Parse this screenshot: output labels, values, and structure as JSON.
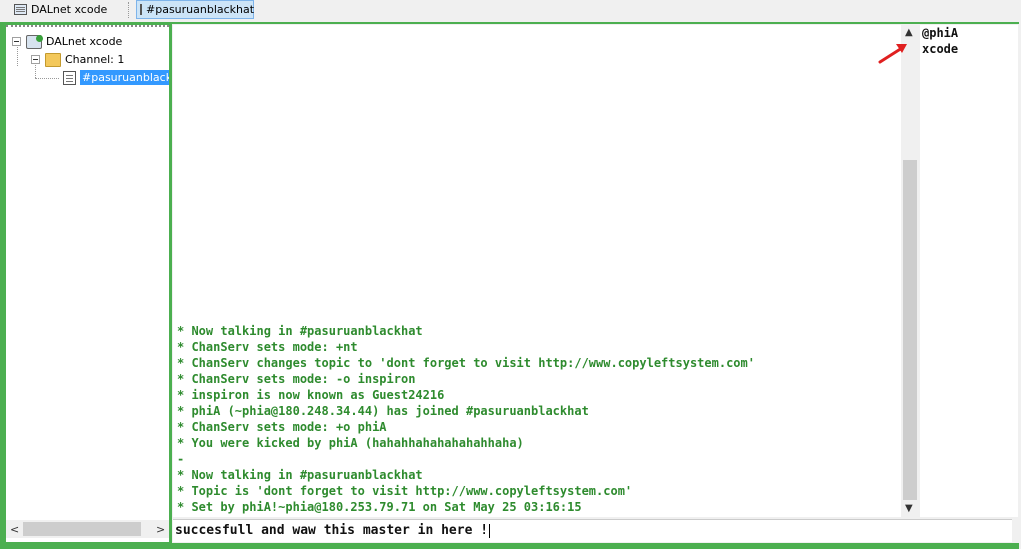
{
  "switchbar": {
    "status_tab": "DALnet xcode",
    "channel_tab": "#pasuruanblackhat"
  },
  "tree": {
    "server": "DALnet xcode",
    "channel_folder": "Channel: 1",
    "channel": "#pasuruanblackhat"
  },
  "messages": [
    "* Now talking in #pasuruanblackhat",
    "* ChanServ sets mode: +nt",
    "* ChanServ changes topic to 'dont forget to visit http://www.copyleftsystem.com'",
    "* ChanServ sets mode: -o inspiron",
    "* inspiron is now known as Guest24216",
    "* phiA (~phia@180.248.34.44) has joined #pasuruanblackhat",
    "* ChanServ sets mode: +o phiA",
    "* You were kicked by phiA (hahahhahahahahahhaha)",
    "-",
    "* Now talking in #pasuruanblackhat",
    "* Topic is 'dont forget to visit http://www.copyleftsystem.com'",
    "* Set by phiA!~phia@180.253.79.71 on Sat May 25 03:16:15"
  ],
  "nicklist": [
    "@phiA",
    "xcode"
  ],
  "editbox": {
    "value": "succesfull and waw this master in here !"
  },
  "colors": {
    "message_text": "#2e8b2e",
    "annotation_arrow": "#e02020",
    "selection": "#3399ff",
    "frame": "#4caf50"
  },
  "icons": {
    "scroll_up": "▲",
    "scroll_down": "▼",
    "scroll_left": "<",
    "scroll_right": ">"
  }
}
